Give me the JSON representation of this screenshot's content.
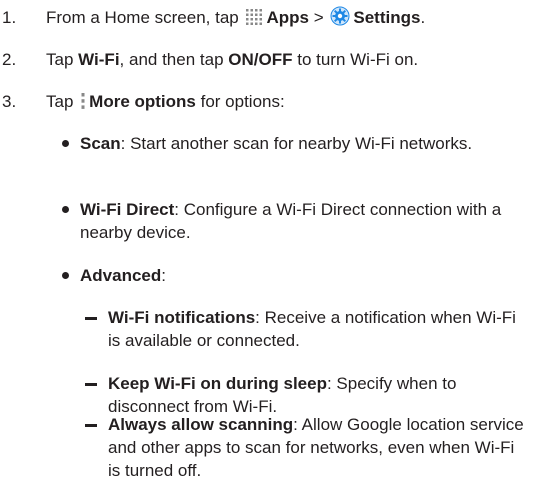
{
  "steps": [
    {
      "number": "1.",
      "prefix": "From a Home screen, tap",
      "apps_label": "Apps",
      "separator": ">",
      "settings_label": "Settings",
      "suffix": "."
    },
    {
      "number": "2.",
      "prefix": "Tap",
      "wifi_label": "Wi-Fi",
      "middle": ", and then tap",
      "onoff_label": "ON/OFF",
      "suffix": "to turn Wi-Fi on."
    },
    {
      "number": "3.",
      "prefix": "Tap",
      "more_label": "More options",
      "suffix": "for options:"
    }
  ],
  "options": [
    {
      "term": "Scan",
      "desc": ": Start another scan for nearby Wi-Fi networks."
    },
    {
      "term": "Wi-Fi Direct",
      "desc": ": Configure a Wi-Fi Direct connection with a nearby device."
    },
    {
      "term": "Advanced",
      "desc": ":"
    }
  ],
  "advanced": [
    {
      "term": "Wi-Fi notifications",
      "desc": ": Receive a notification when Wi-Fi is available or connected."
    },
    {
      "term": "Keep Wi-Fi on during sleep",
      "desc": ": Specify when to disconnect from Wi-Fi."
    },
    {
      "term": "Always allow scanning",
      "desc": ": Allow Google location service and other apps to scan for networks, even when Wi-Fi is turned off."
    }
  ],
  "icons": {
    "apps": "apps-grid-icon",
    "settings": "settings-gear-icon",
    "more_options": "more-options-icon"
  },
  "colors": {
    "text": "#231f20",
    "settings_icon": "#1e88e5"
  }
}
